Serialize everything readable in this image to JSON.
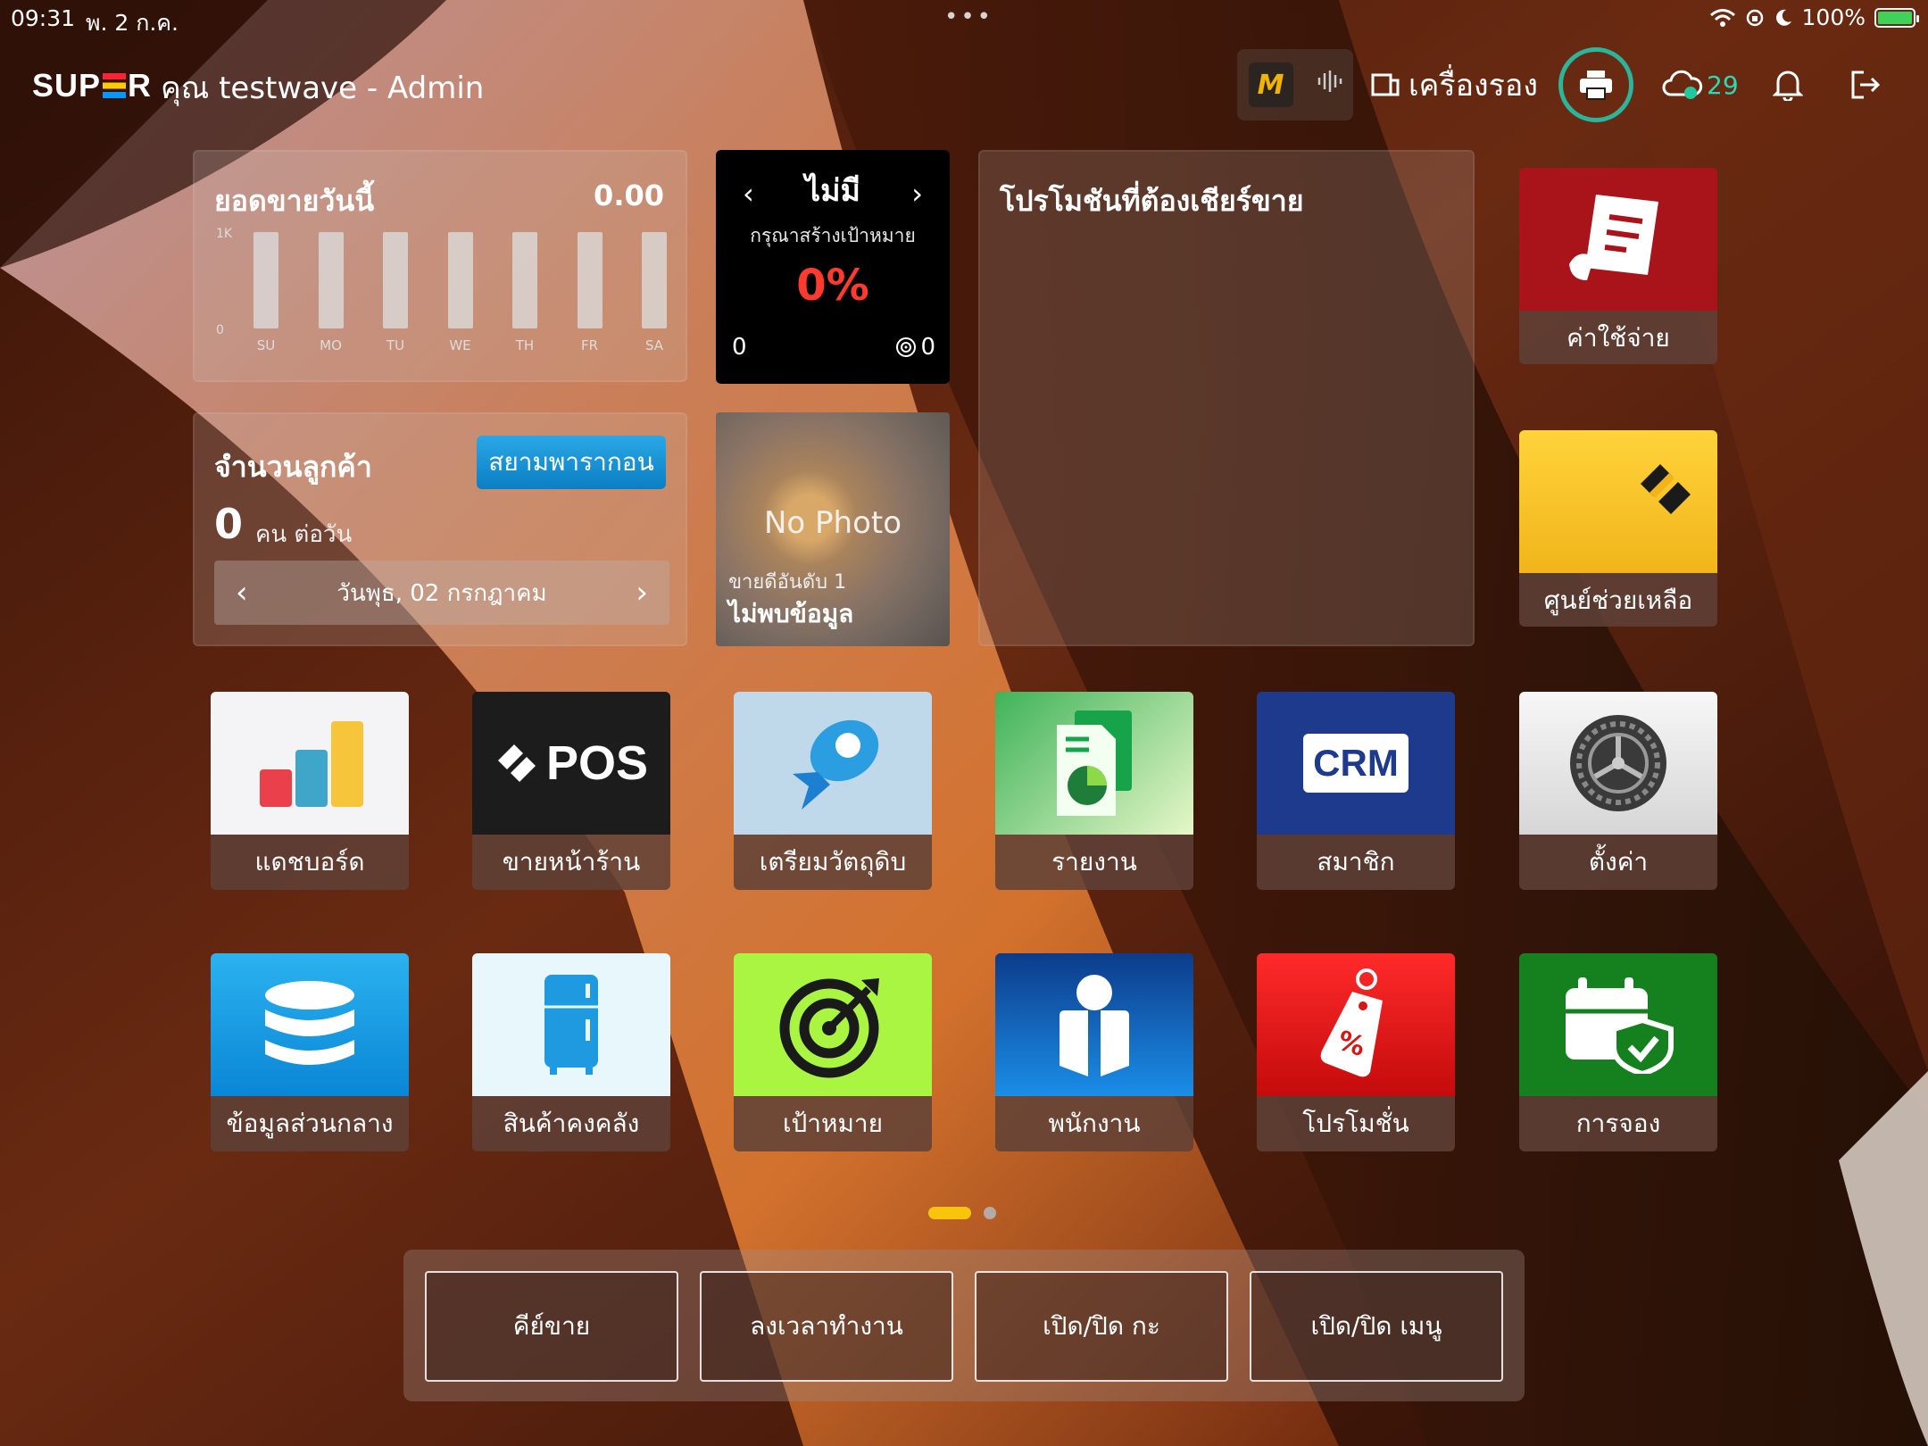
{
  "status_bar": {
    "time": "09:31",
    "date": "พ. 2 ก.ค.",
    "dots": "•••",
    "battery_percent": "100%"
  },
  "header": {
    "logo_left": "SUP",
    "logo_right": "R",
    "user_title": "คุณ testwave - Admin",
    "device_label": "เครื่องรอง",
    "cloud_count": "29"
  },
  "sales_today": {
    "title": "ยอดขายวันนี้",
    "amount": "0.00",
    "y_top": "1K",
    "y_bottom": "0",
    "chart_data": {
      "type": "bar",
      "categories": [
        "SU",
        "MO",
        "TU",
        "WE",
        "TH",
        "FR",
        "SA"
      ],
      "values": [
        0,
        0,
        0,
        0,
        0,
        0,
        0
      ],
      "ylim": [
        0,
        1000
      ]
    }
  },
  "target_card": {
    "prev": "‹",
    "next": "›",
    "name": "ไม่มี",
    "hint": "กรุณาสร้างเป้าหมาย",
    "percent": "0%",
    "min": "0",
    "max": "0"
  },
  "promo_panel": {
    "title": "โปรโมชันที่ต้องเชียร์ขาย"
  },
  "customers": {
    "title": "จำนวนลูกค้า",
    "button": "สยามพารากอน",
    "count": "0",
    "unit": "คน ต่อวัน",
    "date": "วันพุธ, 02 กรกฎาคม",
    "prev": "‹",
    "next": "›"
  },
  "bestseller": {
    "no_photo": "No Photo",
    "rank": "ขายดีอันดับ 1",
    "name": "ไม่พบข้อมูล"
  },
  "tiles": {
    "expense": "ค่าใช้จ่าย",
    "help": "ศูนย์ช่วยเหลือ",
    "dashboard": "แดชบอร์ด",
    "pos": "ขายหน้าร้าน",
    "pos_text": "POS",
    "ingredients": "เตรียมวัตถุดิบ",
    "report": "รายงาน",
    "member": "สมาชิก",
    "crm_text": "CRM",
    "settings": "ตั้งค่า",
    "master_data": "ข้อมูลส่วนกลาง",
    "inventory": "สินค้าคงคลัง",
    "goal": "เป้าหมาย",
    "staff": "พนักงาน",
    "promotion": "โปรโมชั่น",
    "booking": "การจอง"
  },
  "bottom_bar": {
    "sale_key": "คีย์ขาย",
    "clock_in": "ลงเวลาทำงาน",
    "shift_toggle": "เปิด/ปิด กะ",
    "menu_toggle": "เปิด/ปิด เมนู"
  }
}
